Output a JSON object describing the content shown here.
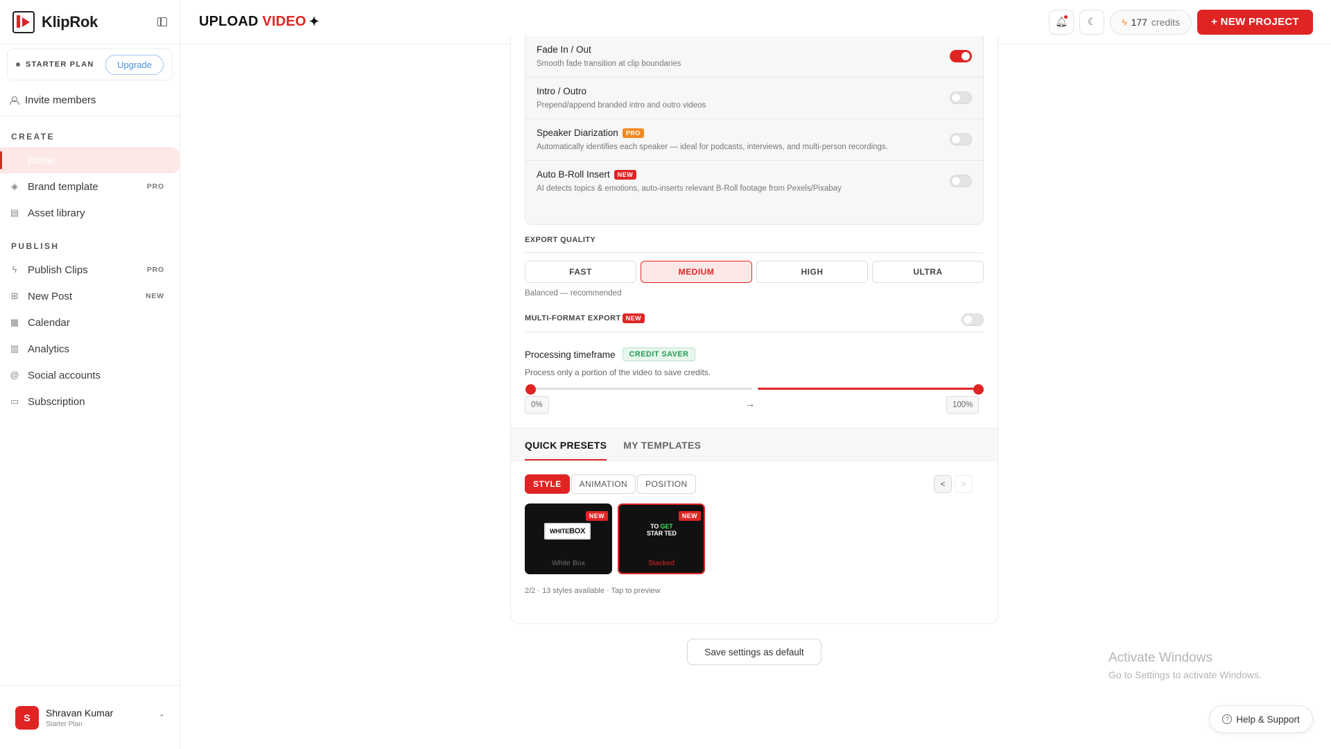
{
  "brand": {
    "name": "KlipRok"
  },
  "plan_card": {
    "plan": "STARTER PLAN",
    "upgrade": "Upgrade"
  },
  "invite": "Invite members",
  "sidebar": {
    "create_label": "CREATE",
    "create_items": [
      {
        "label": "Home",
        "icon": "home-icon",
        "tag": ""
      },
      {
        "label": "Brand template",
        "icon": "layers-icon",
        "tag": "PRO"
      },
      {
        "label": "Asset library",
        "icon": "archive-icon",
        "tag": ""
      }
    ],
    "publish_label": "PUBLISH",
    "publish_items": [
      {
        "label": "Publish Clips",
        "icon": "bolt-icon",
        "tag": "PRO"
      },
      {
        "label": "New Post",
        "icon": "plus-square-icon",
        "tag": "NEW"
      },
      {
        "label": "Calendar",
        "icon": "calendar-icon",
        "tag": ""
      },
      {
        "label": "Analytics",
        "icon": "bar-chart-icon",
        "tag": ""
      },
      {
        "label": "Social accounts",
        "icon": "at-sign-icon",
        "tag": ""
      },
      {
        "label": "Subscription",
        "icon": "card-icon",
        "tag": ""
      }
    ]
  },
  "user": {
    "initial": "S",
    "name": "Shravan Kumar",
    "plan": "Starter Plan"
  },
  "header": {
    "title_part1": "UPLOAD",
    "title_part2": "VIDEO",
    "credits_value": "177",
    "credits_label": "credits",
    "new_project": "+ NEW PROJECT"
  },
  "options": [
    {
      "title": "Fade In / Out",
      "badge": "",
      "desc": "Smooth fade transition at clip boundaries",
      "enabled": true
    },
    {
      "title": "Intro / Outro",
      "badge": "",
      "desc": "Prepend/append branded intro and outro videos",
      "enabled": false
    },
    {
      "title": "Speaker Diarization",
      "badge": "PRO",
      "desc": "Automatically identifies each speaker — ideal for podcasts, interviews, and multi-person recordings.",
      "enabled": false
    },
    {
      "title": "Auto B-Roll Insert",
      "badge": "NEW",
      "desc": "AI detects topics & emotions, auto-inserts relevant B-Roll footage from Pexels/Pixabay",
      "enabled": false
    }
  ],
  "export_quality": {
    "label": "EXPORT QUALITY",
    "options": [
      "FAST",
      "MEDIUM",
      "HIGH",
      "ULTRA"
    ],
    "selected": "MEDIUM",
    "hint": "Balanced — recommended"
  },
  "multi_format": {
    "label": "MULTI-FORMAT EXPORT",
    "badge": "NEW",
    "enabled": false
  },
  "timeframe": {
    "label": "Processing timeframe",
    "badge": "CREDIT SAVER",
    "desc": "Process only a portion of the video to save credits.",
    "start": "0%",
    "end": "100%",
    "arrow": "→"
  },
  "presets": {
    "tabs": [
      "QUICK PRESETS",
      "MY TEMPLATES"
    ],
    "active_tab": "QUICK PRESETS",
    "chips": [
      "STYLE",
      "ANIMATION",
      "POSITION"
    ],
    "active_chip": "STYLE",
    "prev": "<",
    "next": ">",
    "cards": [
      {
        "name": "White Box",
        "ribbon": "NEW",
        "preview_a": "WHITE",
        "preview_b": "BOX",
        "selected": false
      },
      {
        "name": "Stacked",
        "ribbon": "NEW",
        "preview_line1_a": "TO",
        "preview_line1_b": "GET",
        "preview_line2": "STAR TED",
        "selected": true
      }
    ],
    "count_line": "2/2 · 13 styles available · Tap to preview"
  },
  "save_default": "Save settings as default",
  "watermark": {
    "line1": "Activate Windows",
    "line2": "Go to Settings to activate Windows."
  },
  "help": "Help & Support"
}
